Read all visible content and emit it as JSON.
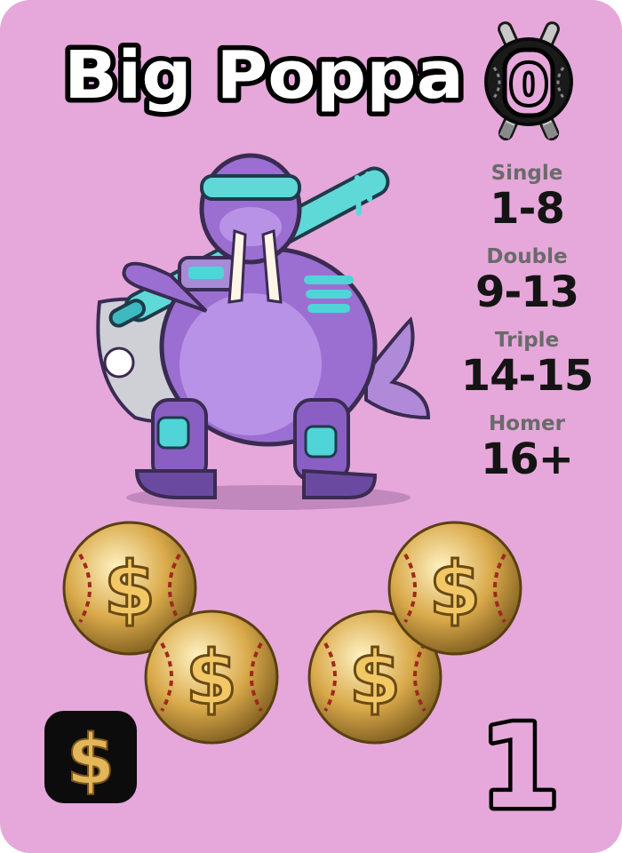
{
  "card": {
    "name": "Big Poppa",
    "badge_value": "0",
    "stats": [
      {
        "label": "Single",
        "range": "1-8"
      },
      {
        "label": "Double",
        "range": "9-13"
      },
      {
        "label": "Triple",
        "range": "14-15"
      },
      {
        "label": "Homer",
        "range": "16+"
      }
    ],
    "coin_symbol": "$",
    "cost_symbol": "$",
    "card_number": "1"
  },
  "colors": {
    "background": "#e6a8da",
    "walrus": "#9b6fd1",
    "accent": "#4fd4d8",
    "gold": "#d9a94a"
  }
}
